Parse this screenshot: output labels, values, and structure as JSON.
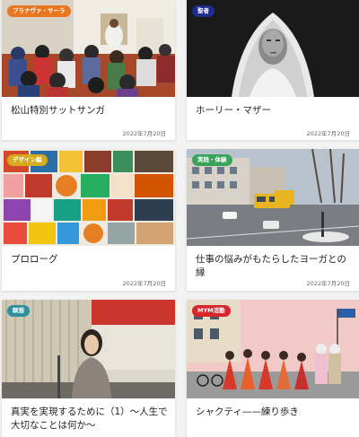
{
  "colors": {
    "orange": "#e8761e",
    "navy": "#1c2d8c",
    "yellow": "#d6ab1c",
    "green": "#3aa35a",
    "teal": "#2b8f9e",
    "red": "#d9252c"
  },
  "cards": [
    {
      "badge": "プラナヴァ・サーラ",
      "badge_color": "orange",
      "title": "松山特別サットサンガ",
      "date": "2022年7月20日"
    },
    {
      "badge": "聖者",
      "badge_color": "navy",
      "title": "ホーリー・マザー",
      "date": "2022年7月20日"
    },
    {
      "badge": "デザイン編",
      "badge_color": "yellow",
      "title": "プロローグ",
      "date": "2022年7月20日"
    },
    {
      "badge": "実践・体験",
      "badge_color": "green",
      "title": "仕事の悩みがもたらしたヨーガとの縁",
      "date": "2022年7月20日"
    },
    {
      "badge": "瞑想",
      "badge_color": "teal",
      "title": "真実を実現するために（1）〜人生で大切なことは何か〜",
      "date": ""
    },
    {
      "badge": "MYM活動",
      "badge_color": "red",
      "title": "シャクティ——練り歩き",
      "date": ""
    }
  ]
}
